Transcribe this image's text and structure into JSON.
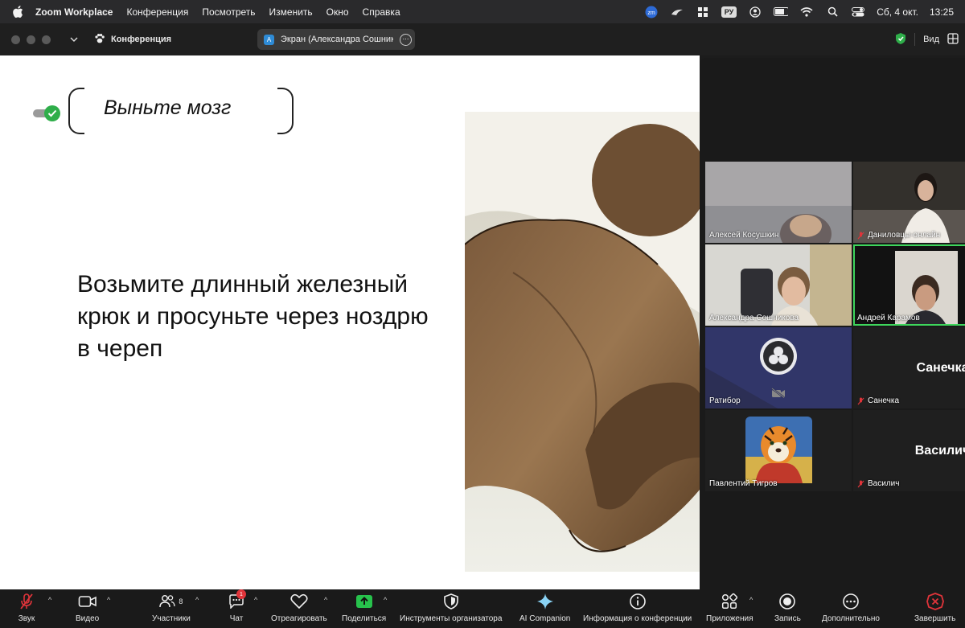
{
  "menubar": {
    "app_name": "Zoom Workplace",
    "items": [
      "Конференция",
      "Посмотреть",
      "Изменить",
      "Окно",
      "Справка"
    ],
    "input_language": "РУ",
    "date": "Сб, 4 окт.",
    "time": "13:25"
  },
  "titlebar": {
    "meeting_title": "Конференция",
    "screen_tab_avatar": "A",
    "screen_tab_label": "Экран (Александра Сошникова)",
    "view_label": "Вид"
  },
  "slide": {
    "heading": "Выньте мозг",
    "body": "Возьмите длинный железный крюк и просуньте через ноздрю в череп"
  },
  "participants": [
    {
      "name": "Алексей Косушкин",
      "muted": false,
      "video": true
    },
    {
      "name": "Даниловцы-онлайн",
      "muted": true,
      "video": true
    },
    {
      "name": "Александра Сошникова",
      "muted": false,
      "video": true
    },
    {
      "name": "Андрей Карамов",
      "muted": false,
      "video": true,
      "speaking": true
    },
    {
      "name": "Ратибор",
      "muted": false,
      "video": false,
      "camera_off": true
    },
    {
      "name": "Санечка",
      "display": "Санечка",
      "muted": true,
      "video": false
    },
    {
      "name": "Павлентий Тигров",
      "muted": false,
      "video": false
    },
    {
      "name": "Василич",
      "display": "Василич",
      "muted": true,
      "video": false
    }
  ],
  "toolbar": {
    "audio": "Звук",
    "video": "Видео",
    "participants": "Участники",
    "participants_count": "8",
    "chat": "Чат",
    "chat_badge": "1",
    "react": "Отреагировать",
    "share": "Поделиться",
    "host_tools": "Инструменты организатора",
    "ai_companion": "AI Companion",
    "meeting_info": "Информация о конференции",
    "apps": "Приложения",
    "record": "Запись",
    "more": "Дополнительно",
    "end": "Завершить"
  },
  "colors": {
    "accent_green": "#2fae4a",
    "end_red": "#e0343a",
    "share_green": "#27c24c"
  }
}
